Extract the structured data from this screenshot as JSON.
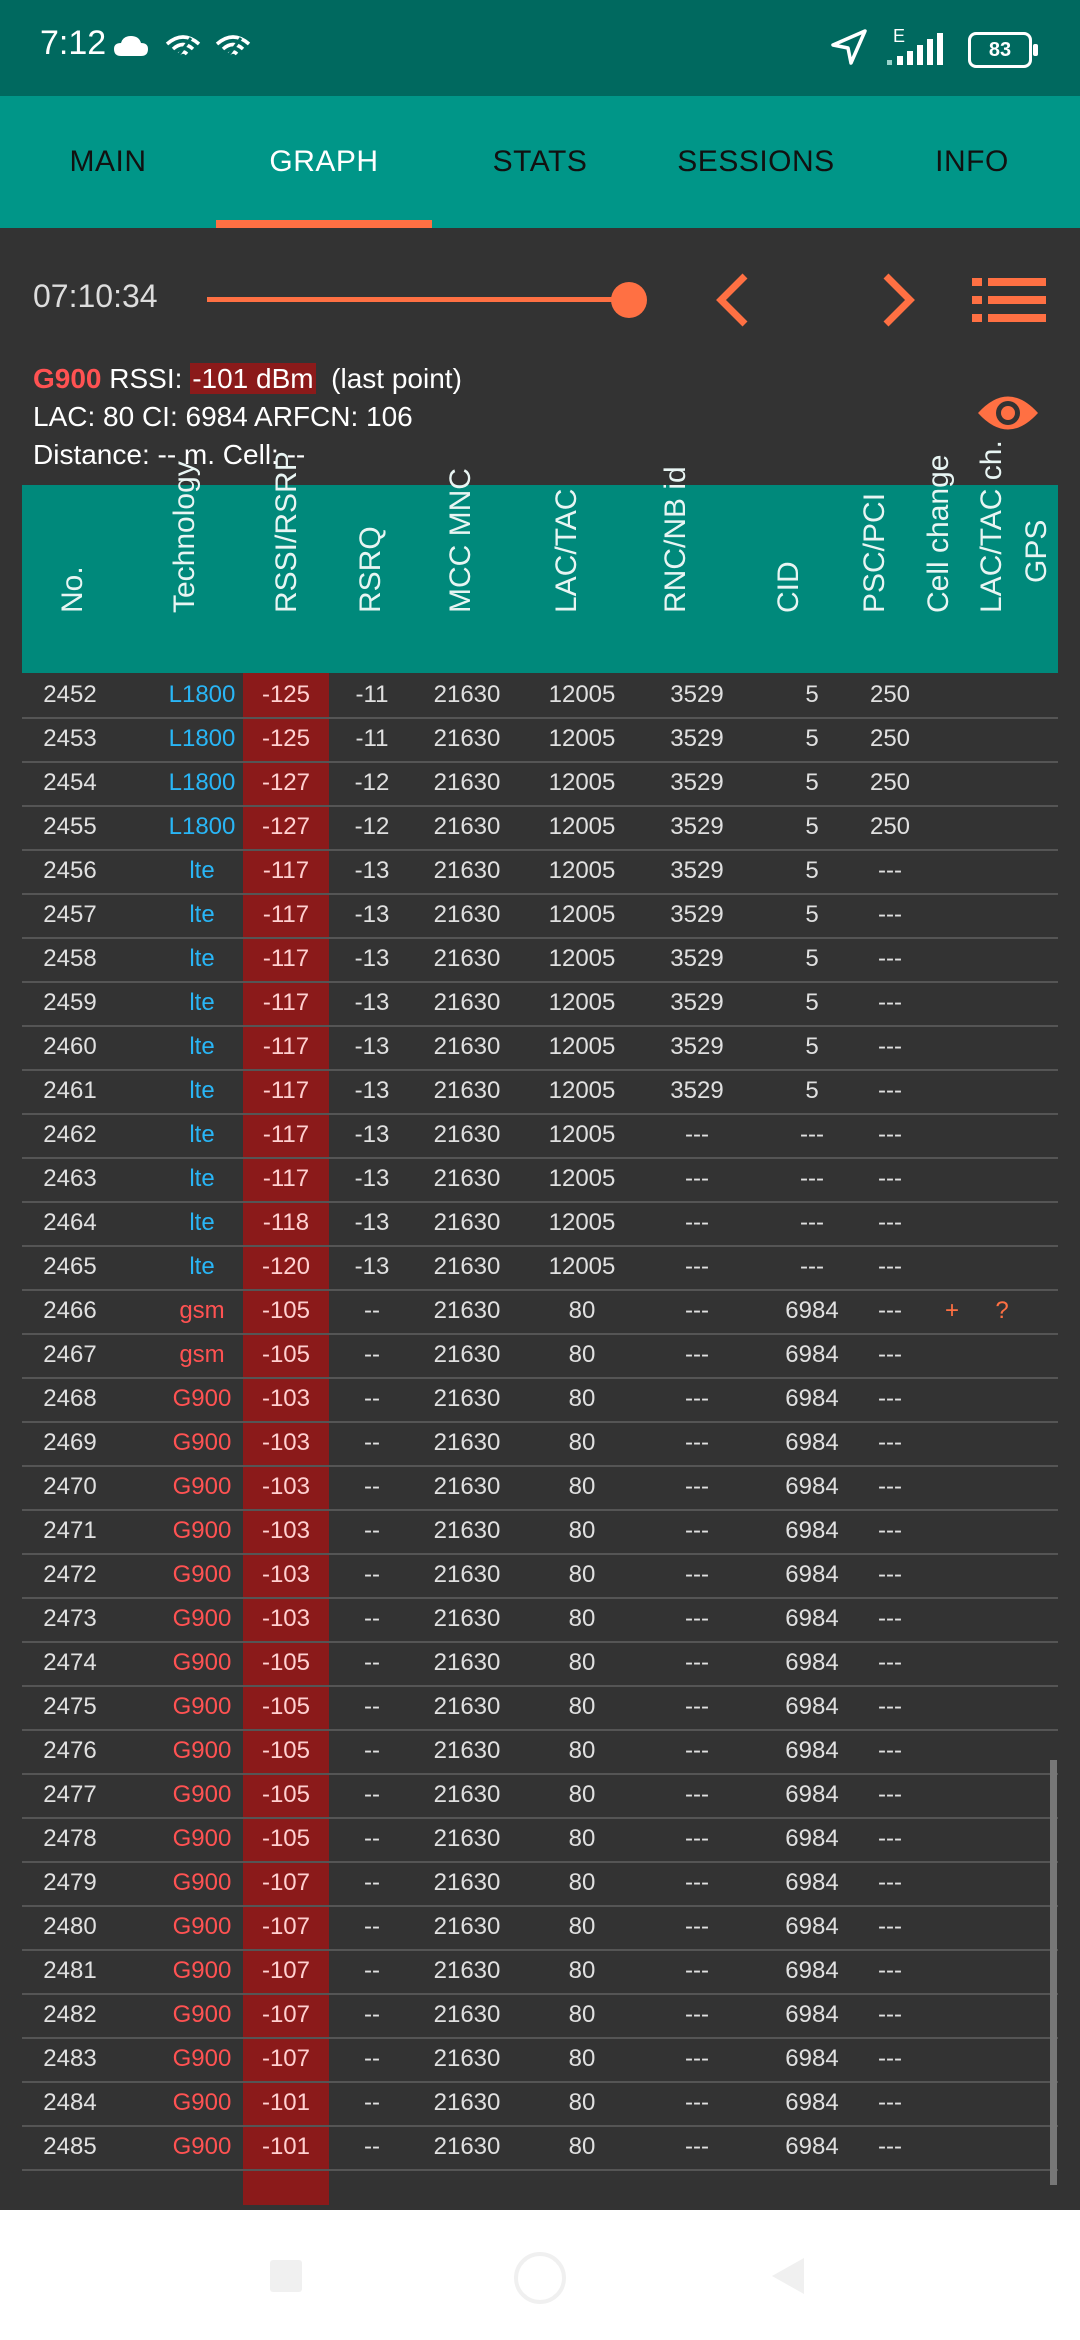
{
  "status_bar": {
    "time": "7:12",
    "battery": "83",
    "network_type": "E"
  },
  "tabs": [
    {
      "label": "MAIN",
      "active": false
    },
    {
      "label": "GRAPH",
      "active": true
    },
    {
      "label": "STATS",
      "active": false
    },
    {
      "label": "SESSIONS",
      "active": false
    },
    {
      "label": "INFO",
      "active": false
    }
  ],
  "toolbar": {
    "time": "07:10:34",
    "slider_position": 1.0
  },
  "info": {
    "technology": "G900",
    "rssi_label": "RSSI:",
    "rssi_value": "-101 dBm",
    "rssi_note": "(last point)",
    "line2": "LAC: 80  CI: 6984  ARFCN: 106",
    "line3": "Distance: -- m.   Cell: --"
  },
  "table": {
    "headers": [
      "No.",
      "Technology",
      "RSSI/RSRP",
      "RSRQ",
      "MCC MNC",
      "LAC/TAC",
      "RNC/NB id",
      "CID",
      "PSC/PCI",
      "Cell change",
      "LAC/TAC ch.",
      "GPS"
    ],
    "rows": [
      [
        "2452",
        "L1800",
        "-125",
        "-11",
        "21630",
        "12005",
        "3529",
        "5",
        "250",
        "",
        ""
      ],
      [
        "2453",
        "L1800",
        "-125",
        "-11",
        "21630",
        "12005",
        "3529",
        "5",
        "250",
        "",
        ""
      ],
      [
        "2454",
        "L1800",
        "-127",
        "-12",
        "21630",
        "12005",
        "3529",
        "5",
        "250",
        "",
        ""
      ],
      [
        "2455",
        "L1800",
        "-127",
        "-12",
        "21630",
        "12005",
        "3529",
        "5",
        "250",
        "",
        ""
      ],
      [
        "2456",
        "lte",
        "-117",
        "-13",
        "21630",
        "12005",
        "3529",
        "5",
        "---",
        "",
        ""
      ],
      [
        "2457",
        "lte",
        "-117",
        "-13",
        "21630",
        "12005",
        "3529",
        "5",
        "---",
        "",
        ""
      ],
      [
        "2458",
        "lte",
        "-117",
        "-13",
        "21630",
        "12005",
        "3529",
        "5",
        "---",
        "",
        ""
      ],
      [
        "2459",
        "lte",
        "-117",
        "-13",
        "21630",
        "12005",
        "3529",
        "5",
        "---",
        "",
        ""
      ],
      [
        "2460",
        "lte",
        "-117",
        "-13",
        "21630",
        "12005",
        "3529",
        "5",
        "---",
        "",
        ""
      ],
      [
        "2461",
        "lte",
        "-117",
        "-13",
        "21630",
        "12005",
        "3529",
        "5",
        "---",
        "",
        ""
      ],
      [
        "2462",
        "lte",
        "-117",
        "-13",
        "21630",
        "12005",
        "---",
        "---",
        "---",
        "",
        ""
      ],
      [
        "2463",
        "lte",
        "-117",
        "-13",
        "21630",
        "12005",
        "---",
        "---",
        "---",
        "",
        ""
      ],
      [
        "2464",
        "lte",
        "-118",
        "-13",
        "21630",
        "12005",
        "---",
        "---",
        "---",
        "",
        ""
      ],
      [
        "2465",
        "lte",
        "-120",
        "-13",
        "21630",
        "12005",
        "---",
        "---",
        "---",
        "",
        ""
      ],
      [
        "2466",
        "gsm",
        "-105",
        "--",
        "21630",
        "80",
        "---",
        "6984",
        "---",
        "+",
        "?"
      ],
      [
        "2467",
        "gsm",
        "-105",
        "--",
        "21630",
        "80",
        "---",
        "6984",
        "---",
        "",
        ""
      ],
      [
        "2468",
        "G900",
        "-103",
        "--",
        "21630",
        "80",
        "---",
        "6984",
        "---",
        "",
        ""
      ],
      [
        "2469",
        "G900",
        "-103",
        "--",
        "21630",
        "80",
        "---",
        "6984",
        "---",
        "",
        ""
      ],
      [
        "2470",
        "G900",
        "-103",
        "--",
        "21630",
        "80",
        "---",
        "6984",
        "---",
        "",
        ""
      ],
      [
        "2471",
        "G900",
        "-103",
        "--",
        "21630",
        "80",
        "---",
        "6984",
        "---",
        "",
        ""
      ],
      [
        "2472",
        "G900",
        "-103",
        "--",
        "21630",
        "80",
        "---",
        "6984",
        "---",
        "",
        ""
      ],
      [
        "2473",
        "G900",
        "-103",
        "--",
        "21630",
        "80",
        "---",
        "6984",
        "---",
        "",
        ""
      ],
      [
        "2474",
        "G900",
        "-105",
        "--",
        "21630",
        "80",
        "---",
        "6984",
        "---",
        "",
        ""
      ],
      [
        "2475",
        "G900",
        "-105",
        "--",
        "21630",
        "80",
        "---",
        "6984",
        "---",
        "",
        ""
      ],
      [
        "2476",
        "G900",
        "-105",
        "--",
        "21630",
        "80",
        "---",
        "6984",
        "---",
        "",
        ""
      ],
      [
        "2477",
        "G900",
        "-105",
        "--",
        "21630",
        "80",
        "---",
        "6984",
        "---",
        "",
        ""
      ],
      [
        "2478",
        "G900",
        "-105",
        "--",
        "21630",
        "80",
        "---",
        "6984",
        "---",
        "",
        ""
      ],
      [
        "2479",
        "G900",
        "-107",
        "--",
        "21630",
        "80",
        "---",
        "6984",
        "---",
        "",
        ""
      ],
      [
        "2480",
        "G900",
        "-107",
        "--",
        "21630",
        "80",
        "---",
        "6984",
        "---",
        "",
        ""
      ],
      [
        "2481",
        "G900",
        "-107",
        "--",
        "21630",
        "80",
        "---",
        "6984",
        "---",
        "",
        ""
      ],
      [
        "2482",
        "G900",
        "-107",
        "--",
        "21630",
        "80",
        "---",
        "6984",
        "---",
        "",
        ""
      ],
      [
        "2483",
        "G900",
        "-107",
        "--",
        "21630",
        "80",
        "---",
        "6984",
        "---",
        "",
        ""
      ],
      [
        "2484",
        "G900",
        "-101",
        "--",
        "21630",
        "80",
        "---",
        "6984",
        "---",
        "",
        ""
      ],
      [
        "2485",
        "G900",
        "-101",
        "--",
        "21630",
        "80",
        "---",
        "6984",
        "---",
        "",
        ""
      ]
    ]
  },
  "colors": {
    "accent": "#ff7043",
    "tab_bg": "#009688",
    "header_bg": "#00897b",
    "lte_color": "#29b6f6",
    "gsm_color": "#ff5252",
    "rssi_bg": "#8b1a1a"
  },
  "icons": [
    "cloud-icon",
    "wifi-icon",
    "location-arrow-icon",
    "signal-icon",
    "battery-icon",
    "chevron-left-icon",
    "chevron-right-icon",
    "list-icon",
    "eye-icon",
    "nav-square-icon",
    "nav-home-icon",
    "nav-back-icon"
  ]
}
